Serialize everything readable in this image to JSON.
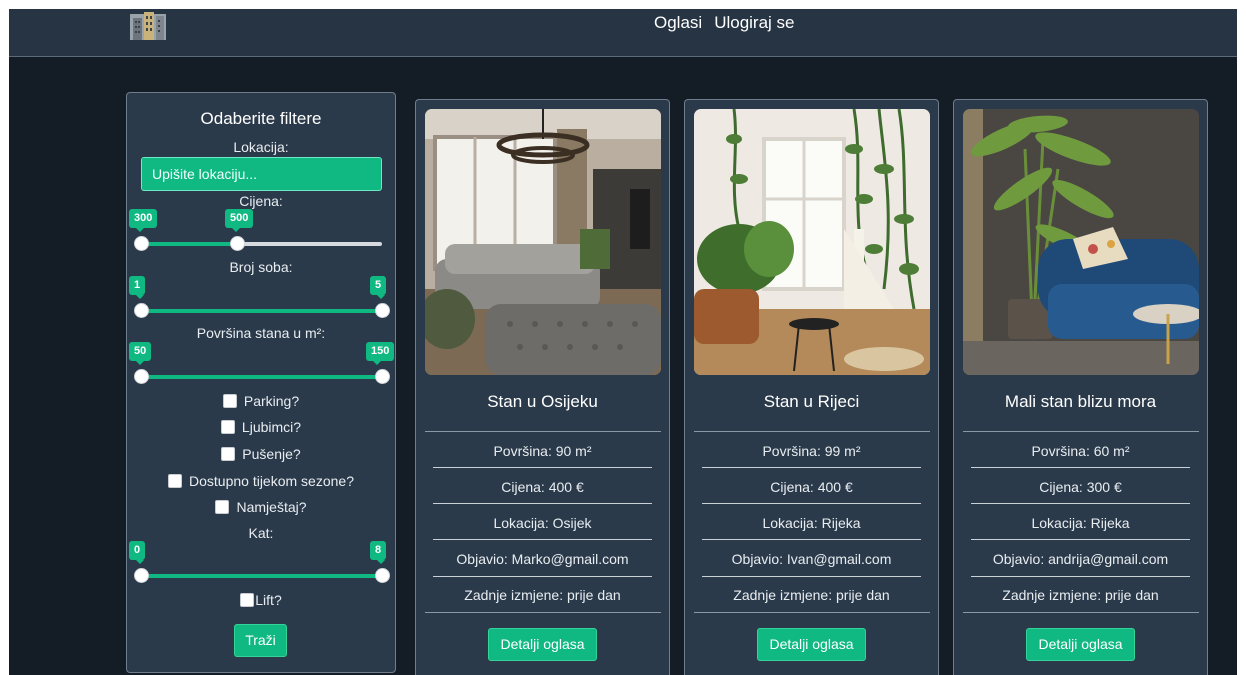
{
  "nav": {
    "oglasi": "Oglasi",
    "login": "Ulogiraj se"
  },
  "colors": {
    "accent": "#10b981",
    "panel": "#2b3a4a",
    "background": "#141d25"
  },
  "filters": {
    "title": "Odaberite filtere",
    "location_label": "Lokacija:",
    "location_placeholder": "Upišite lokaciju...",
    "location_value": "",
    "price_label": "Cijena:",
    "price_min": "300",
    "price_max": "500",
    "rooms_label": "Broj soba:",
    "rooms_min": "1",
    "rooms_max": "5",
    "area_label": "Površina stana u m²:",
    "area_min": "50",
    "area_max": "150",
    "parking": "Parking?",
    "pets": "Ljubimci?",
    "smoking": "Pušenje?",
    "seasonal": "Dostupno tijekom sezone?",
    "furniture": "Namještaj?",
    "floor_label": "Kat:",
    "floor_min": "0",
    "floor_max": "8",
    "lift": "Lift?",
    "search_button": "Traži"
  },
  "listings": [
    {
      "title": "Stan u Osijeku",
      "area": "Površina: 90 m²",
      "price": "Cijena: 400 €",
      "location": "Lokacija: Osijek",
      "posted_by": "Objavio: Marko@gmail.com",
      "updated": "Zadnje izmjene: prije dan",
      "button": "Detalji oglasa",
      "image_icon": "living-room-photo"
    },
    {
      "title": "Stan u Rijeci",
      "area": "Površina: 99 m²",
      "price": "Cijena: 400 €",
      "location": "Lokacija: Rijeka",
      "posted_by": "Objavio: Ivan@gmail.com",
      "updated": "Zadnje izmjene: prije dan",
      "button": "Detalji oglasa",
      "image_icon": "plants-room-photo"
    },
    {
      "title": "Mali stan blizu mora",
      "area": "Površina: 60 m²",
      "price": "Cijena: 300 €",
      "location": "Lokacija: Rijeka",
      "posted_by": "Objavio: andrija@gmail.com",
      "updated": "Zadnje izmjene: prije dan",
      "button": "Detalji oglasa",
      "image_icon": "blue-sofa-photo"
    }
  ]
}
